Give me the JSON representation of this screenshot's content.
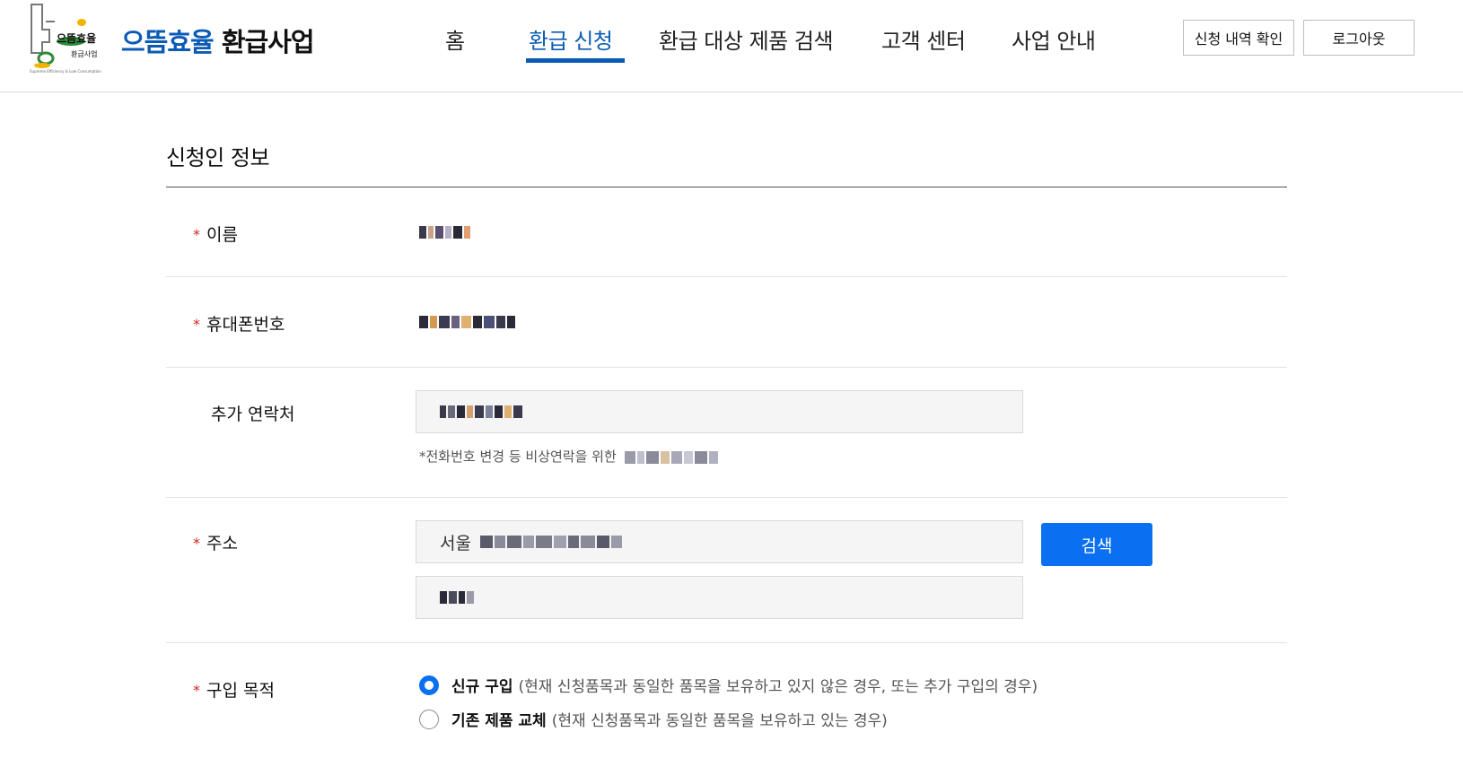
{
  "header": {
    "logo_small_text_1": "으뜸효율",
    "logo_small_text_2": "환급사업",
    "logo_tagline": "Supreme Efficiency & Low Consumption",
    "logo_title_blue": "으뜸효율",
    "logo_title_black": "환급사업",
    "nav": [
      {
        "label": "홈",
        "active": false
      },
      {
        "label": "환급 신청",
        "active": true
      },
      {
        "label": "환급 대상 제품 검색",
        "active": false
      },
      {
        "label": "고객 센터",
        "active": false
      },
      {
        "label": "사업 안내",
        "active": false
      }
    ],
    "history_button": "신청 내역 확인",
    "logout_button": "로그아웃"
  },
  "form": {
    "section_title": "신청인 정보",
    "name_label": "이름",
    "phone_label": "휴대폰번호",
    "extra_contact_label": "추가 연락처",
    "extra_contact_hint": "*전화번호 변경 등 비상연락을 위한",
    "address_label": "주소",
    "address_value_prefix": "서울",
    "address_search_button": "검색",
    "purpose_label": "구입 목적",
    "purpose_options": [
      {
        "label": "신규 구입",
        "desc": "(현재 신청품목과 동일한 품목을 보유하고 있지 않은 경우, 또는 추가 구입의 경우)",
        "selected": true
      },
      {
        "label": "기존 제품 교체",
        "desc": "(현재 신청품목과 동일한 품목을 보유하고 있는 경우)",
        "selected": false
      }
    ],
    "required_mark": "*"
  },
  "colors": {
    "brand_blue": "#0a5bb5",
    "button_blue": "#0a6ff0",
    "required_red": "#d71f1f"
  }
}
